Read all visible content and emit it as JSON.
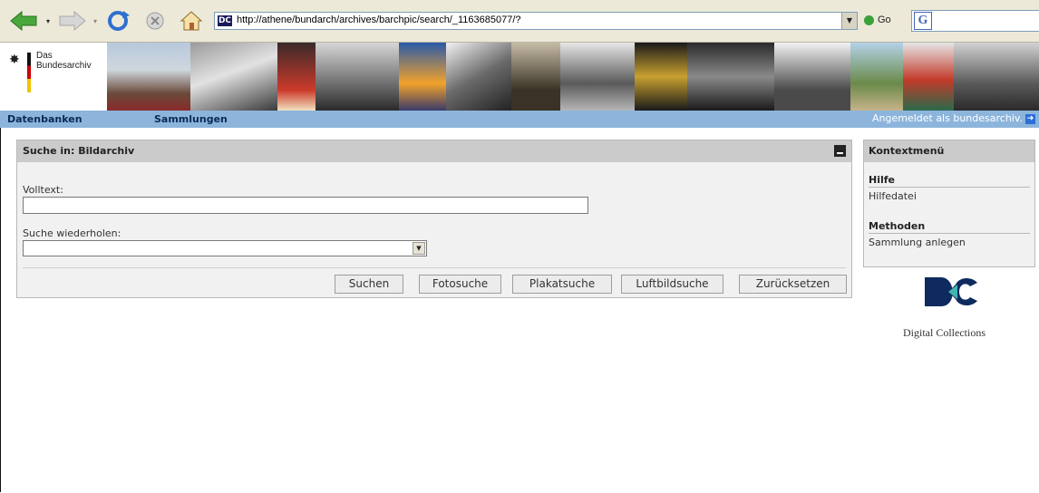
{
  "browser": {
    "address_url": "http://athene/bundarch/archives/barchpic/search/_1163685077/?",
    "go_label": "Go",
    "favicon_text": "DC"
  },
  "banner": {
    "logo_line1": "Das",
    "logo_line2": "Bundesarchiv"
  },
  "menu": {
    "databases": "Datenbanken",
    "collections": "Sammlungen",
    "login_status": "Angemeldet als bundesarchiv."
  },
  "search_panel": {
    "title": "Suche in: Bildarchiv",
    "fulltext_label": "Volltext:",
    "fulltext_value": "",
    "repeat_label": "Suche wiederholen:",
    "repeat_value": "",
    "buttons": {
      "search": "Suchen",
      "photo_search": "Fotosuche",
      "poster_search": "Plakatsuche",
      "aerial_search": "Luftbildsuche",
      "reset": "Zurücksetzen"
    }
  },
  "context_menu": {
    "title": "Kontextmenü",
    "help_heading": "Hilfe",
    "help_link": "Hilfedatei",
    "methods_heading": "Methoden",
    "methods_link": "Sammlung anlegen"
  },
  "brand": {
    "name": "Digital Collections",
    "accent": "#0f2a5e"
  },
  "colors": {
    "menubar": "#8db5dc",
    "panel_header": "#cbcbcb"
  }
}
